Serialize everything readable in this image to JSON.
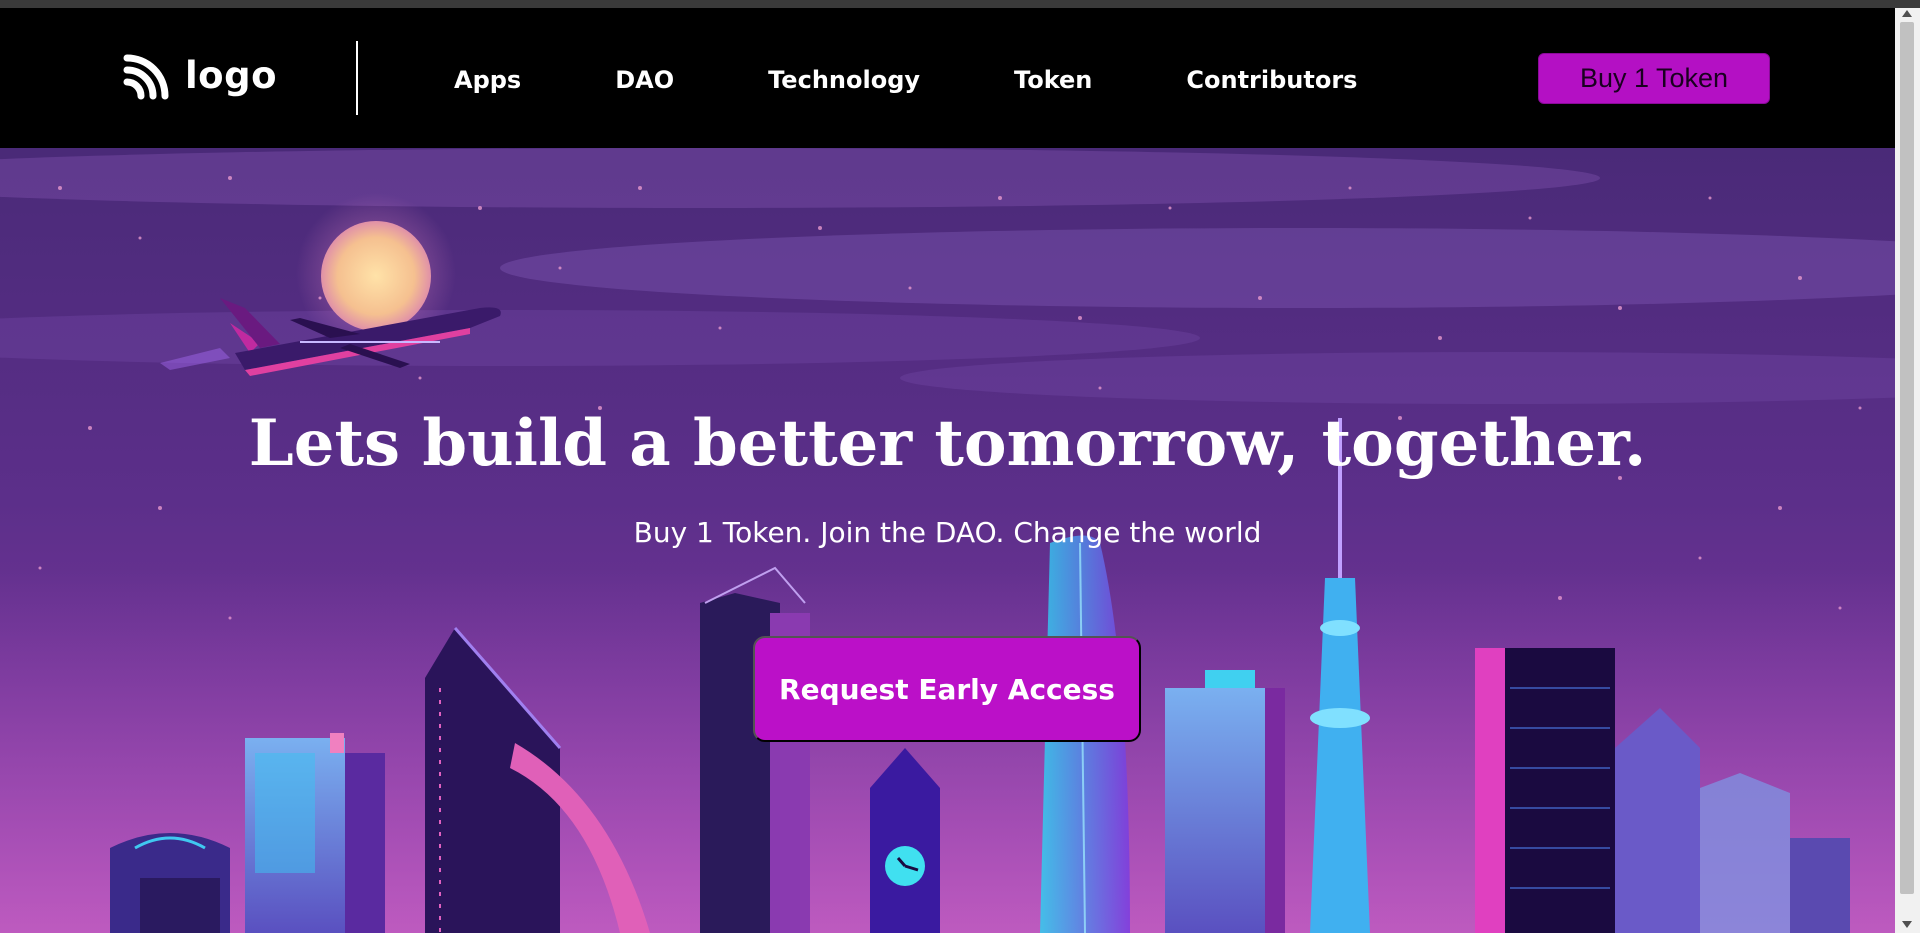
{
  "nav": {
    "logo_text": "logo",
    "links": [
      {
        "label": "Apps"
      },
      {
        "label": "DAO"
      },
      {
        "label": "Technology"
      },
      {
        "label": "Token"
      },
      {
        "label": "Contributors"
      }
    ],
    "buy_button": "Buy 1 Token"
  },
  "hero": {
    "title": "Lets build a better tomorrow, together.",
    "subtitle": "Buy 1 Token. Join the DAO. Change the world",
    "cta": "Request Early Access"
  },
  "colors": {
    "accent": "#b410c4",
    "nav_bg": "#000000",
    "sky_top": "#4a2a78",
    "sky_bottom": "#7a3aa0"
  },
  "icons": {
    "logo": "rss-like-logo-icon"
  }
}
